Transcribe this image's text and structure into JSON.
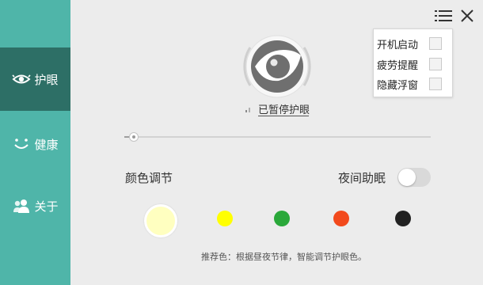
{
  "sidebar": {
    "items": [
      {
        "label": "护眼",
        "icon": "eye-icon",
        "active": true
      },
      {
        "label": "健康",
        "icon": "smile-icon",
        "active": false
      },
      {
        "label": "关于",
        "icon": "users-icon",
        "active": false
      }
    ]
  },
  "toolbar": {
    "menu_icon": "menu-list-icon",
    "close_icon": "close-icon"
  },
  "menu": {
    "items": [
      {
        "label": "开机启动",
        "checked": false
      },
      {
        "label": "疲劳提醒",
        "checked": false
      },
      {
        "label": "隐藏浮窗",
        "checked": false
      }
    ]
  },
  "status": {
    "text": "已暂停护眼",
    "icon": "eye-toggle-icon"
  },
  "slider": {
    "level": 0.03
  },
  "color": {
    "label": "颜色调节",
    "swatches": [
      "#ffffc0",
      "#ffff00",
      "#2aa83a",
      "#f2491c",
      "#222222"
    ],
    "selected_index": 0,
    "hint": "推荐色：根据昼夜节律，智能调节护眼色。"
  },
  "night": {
    "label": "夜间助眠",
    "enabled": false
  },
  "colors": {
    "sidebar": "#4fb5a9",
    "sidebar_active": "#2d6f66",
    "background": "#ececec"
  }
}
